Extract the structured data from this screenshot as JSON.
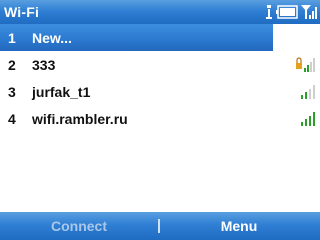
{
  "title": "Wi-Fi",
  "status_icons": [
    "antenna-icon",
    "battery-icon",
    "signal-strength-icon"
  ],
  "networks": [
    {
      "number": "1",
      "name": "New...",
      "selected": true
    },
    {
      "number": "2",
      "name": "333",
      "secured": true,
      "signal_bars": 2
    },
    {
      "number": "3",
      "name": "jurfak_t1",
      "secured": false,
      "signal_bars": 2
    },
    {
      "number": "4",
      "name": "wifi.rambler.ru",
      "secured": false,
      "signal_bars": 4
    }
  ],
  "softkeys": {
    "left": "Connect",
    "left_enabled": false,
    "right": "Menu"
  },
  "colors": {
    "accent": "#2f7fd4",
    "signal_green": "#2aa02a",
    "signal_gray": "#cfcfcf",
    "lock": "#e3a21a"
  }
}
